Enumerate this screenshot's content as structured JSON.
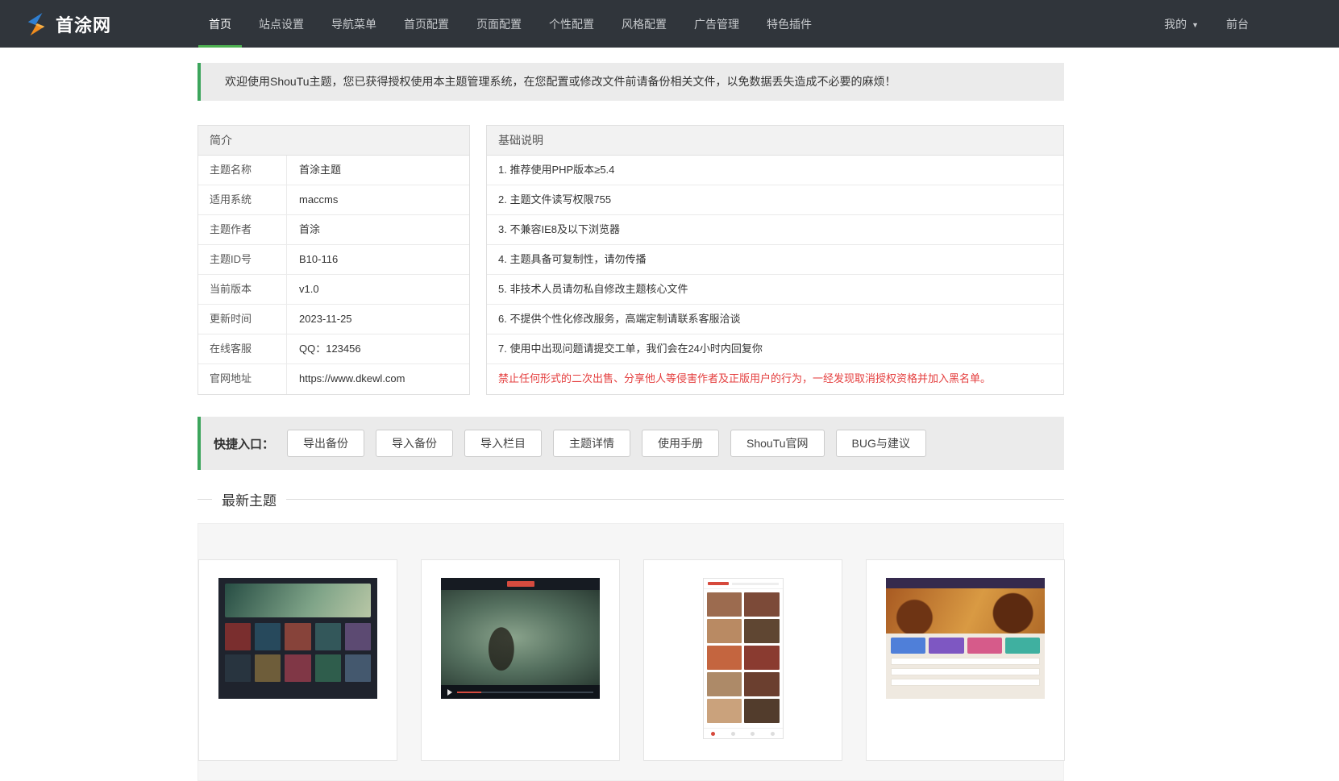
{
  "colors": {
    "accent": "#3ca55c",
    "navbar_bg": "#30353b",
    "warning_red": "#e43d3d"
  },
  "navbar": {
    "logo_text": "首涂网",
    "items": [
      {
        "label": "首页",
        "active": true
      },
      {
        "label": "站点设置",
        "active": false
      },
      {
        "label": "导航菜单",
        "active": false
      },
      {
        "label": "首页配置",
        "active": false
      },
      {
        "label": "页面配置",
        "active": false
      },
      {
        "label": "个性配置",
        "active": false
      },
      {
        "label": "风格配置",
        "active": false
      },
      {
        "label": "广告管理",
        "active": false
      },
      {
        "label": "特色插件",
        "active": false
      }
    ],
    "my_label": "我的",
    "front_label": "前台"
  },
  "welcome": "欢迎使用ShouTu主题，您已获得授权使用本主题管理系统，在您配置或修改文件前请备份相关文件，以免数据丢失造成不必要的麻烦！",
  "intro": {
    "title": "简介",
    "rows": [
      {
        "label": "主题名称",
        "value": "首涂主题"
      },
      {
        "label": "适用系统",
        "value": "maccms"
      },
      {
        "label": "主题作者",
        "value": "首涂"
      },
      {
        "label": "主题ID号",
        "value": "B10-116"
      },
      {
        "label": "当前版本",
        "value": "v1.0"
      },
      {
        "label": "更新时间",
        "value": "2023-11-25"
      },
      {
        "label": "在线客服",
        "value": "QQ：123456"
      },
      {
        "label": "官网地址",
        "value": "https://www.dkewl.com"
      }
    ]
  },
  "instructions": {
    "title": "基础说明",
    "items": [
      "1. 推荐使用PHP版本≥5.4",
      "2. 主题文件读写权限755",
      "3. 不兼容IE8及以下浏览器",
      "4. 主题具备可复制性，请勿传播",
      "5. 非技术人员请勿私自修改主题核心文件",
      "6. 不提供个性化修改服务，高端定制请联系客服洽谈",
      "7. 使用中出现问题请提交工单，我们会在24小时内回复你"
    ],
    "warning": "禁止任何形式的二次出售、分享他人等侵害作者及正版用户的行为，一经发现取消授权资格并加入黑名单。"
  },
  "quick_entry": {
    "label": "快捷入口：",
    "buttons": [
      "导出备份",
      "导入备份",
      "导入栏目",
      "主题详情",
      "使用手册",
      "ShouTu官网",
      "BUG与建议"
    ]
  },
  "latest_themes": {
    "title": "最新主题",
    "cards": [
      {
        "preview": "dark-movie-grid-theme"
      },
      {
        "preview": "video-player-theme"
      },
      {
        "preview": "mobile-app-theme"
      },
      {
        "preview": "game-portal-theme"
      }
    ]
  }
}
